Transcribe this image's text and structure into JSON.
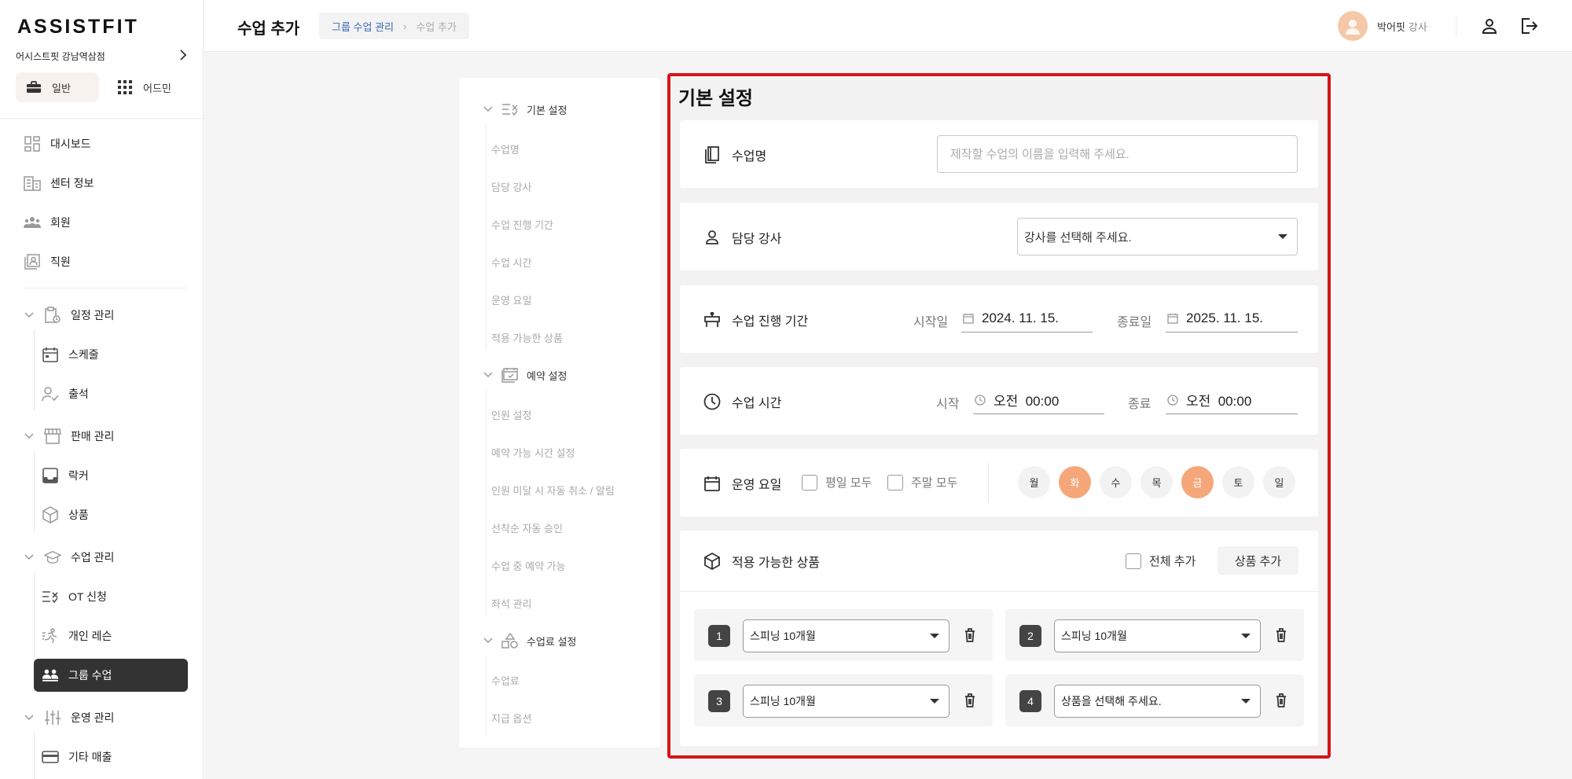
{
  "app": {
    "logo": "ASSISTFIT",
    "branch": "어시스트핏 강남역삼점",
    "mode_tabs": [
      {
        "label": "일반",
        "icon": "briefcase-icon"
      },
      {
        "label": "어드민",
        "icon": "grid-icon"
      }
    ]
  },
  "sidebar": {
    "top_items": [
      {
        "label": "대시보드",
        "icon": "dashboard-icon"
      },
      {
        "label": "센터 정보",
        "icon": "building-icon"
      },
      {
        "label": "회원",
        "icon": "members-icon"
      },
      {
        "label": "직원",
        "icon": "staff-icon"
      }
    ],
    "groups": [
      {
        "label": "일정 관리",
        "icon": "calendar-clipboard-icon",
        "items": [
          {
            "label": "스케줄",
            "icon": "calendar-icon"
          },
          {
            "label": "출석",
            "icon": "user-check-icon"
          }
        ]
      },
      {
        "label": "판매 관리",
        "icon": "store-icon",
        "items": [
          {
            "label": "락커",
            "icon": "inbox-icon"
          },
          {
            "label": "상품",
            "icon": "cube-icon"
          }
        ]
      },
      {
        "label": "수업 관리",
        "icon": "graduation-cap-icon",
        "items": [
          {
            "label": "OT 신청",
            "icon": "list-check-icon"
          },
          {
            "label": "개인 레슨",
            "icon": "running-icon"
          },
          {
            "label": "그룹 수업",
            "icon": "group-icon"
          }
        ]
      },
      {
        "label": "운영 관리",
        "icon": "sliders-icon",
        "items": [
          {
            "label": "기타 매출",
            "icon": "credit-card-icon"
          }
        ]
      }
    ]
  },
  "header": {
    "title": "수업 추가",
    "breadcrumb": {
      "parent": "그룹 수업 관리",
      "separator": "›",
      "current": "수업 추가"
    },
    "user": {
      "name": "박어핏",
      "role": "강사"
    }
  },
  "section_nav": [
    {
      "label": "기본 설정",
      "icon": "list-check-icon",
      "items": [
        "수업명",
        "담당 강사",
        "수업 진행 기간",
        "수업 시간",
        "운영 요일",
        "적용 가능한 상품"
      ]
    },
    {
      "label": "예약 설정",
      "icon": "calendar-check-icon",
      "items": [
        "인원 설정",
        "예약 가능 시간 설정",
        "인원 미달 시 자동 취소 / 알림",
        "선착순 자동 승인",
        "수업 중 예약 가능",
        "좌석 관리"
      ]
    },
    {
      "label": "수업료 설정",
      "icon": "shapes-icon",
      "items": [
        "수업료",
        "지급 옵션"
      ]
    }
  ],
  "form": {
    "title": "기본 설정",
    "class_name": {
      "label": "수업명",
      "placeholder": "제작할 수업의 이름을 입력해 주세요.",
      "value": ""
    },
    "instructor": {
      "label": "담당 강사",
      "value": "강사를 선택해 주세요."
    },
    "period": {
      "label": "수업 진행 기간",
      "start_label": "시작일",
      "start_value": "2024. 11. 15.",
      "end_label": "종료일",
      "end_value": "2025. 11. 15."
    },
    "time": {
      "label": "수업 시간",
      "start_label": "시작",
      "start_value": "오전  00:00",
      "end_label": "종료",
      "end_value": "오전  00:00"
    },
    "days": {
      "label": "운영 요일",
      "weekdays_all": "평일 모두",
      "weekend_all": "주말 모두",
      "list": [
        {
          "label": "월",
          "selected": false
        },
        {
          "label": "화",
          "selected": true
        },
        {
          "label": "수",
          "selected": false
        },
        {
          "label": "목",
          "selected": false
        },
        {
          "label": "금",
          "selected": true
        },
        {
          "label": "토",
          "selected": false
        },
        {
          "label": "일",
          "selected": false
        }
      ]
    },
    "products": {
      "label": "적용 가능한 상품",
      "add_all_label": "전체 추가",
      "add_button": "상품 추가",
      "items": [
        {
          "num": "1",
          "value": "스피닝 10개월"
        },
        {
          "num": "2",
          "value": "스피닝 10개월"
        },
        {
          "num": "3",
          "value": "스피닝 10개월"
        },
        {
          "num": "4",
          "value": "상품을 선택해 주세요."
        }
      ]
    }
  },
  "colors": {
    "accent": "#f5a77a",
    "highlight_border": "#d6141a",
    "active_nav": "#333333",
    "link": "#3b6bb5"
  }
}
